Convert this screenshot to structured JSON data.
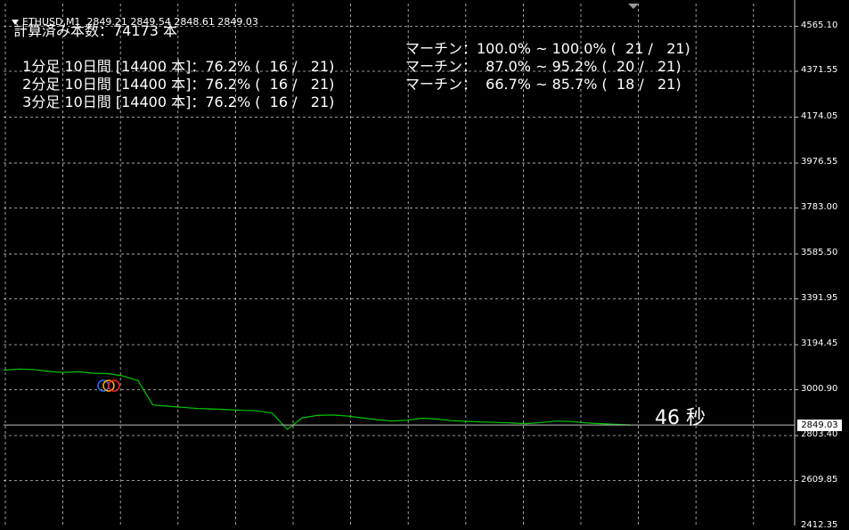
{
  "header": {
    "symbol": "ETHUSD,M1",
    "ohlc": "2849.21 2849.54 2848.61 2849.03"
  },
  "stats": {
    "calc_count": "計算済み本数：74173 本",
    "rows": [
      {
        "label": "1分足 10日間 [14400 本]：76.2% (  16 /   21)",
        "martin": "マーチン：100.0% ~ 100.0% (  21 /   21)"
      },
      {
        "label": "2分足 10日間 [14400 本]：76.2% (  16 /   21)",
        "martin": "マーチン：  87.0% ~ 95.2% (  20 /   21)"
      },
      {
        "label": "3分足 10日間 [14400 本]：76.2% (  16 /   21)",
        "martin": "マーチン：  66.7% ~ 85.7% (  18 /   21)"
      }
    ]
  },
  "timer": "46 秒",
  "current_price": "2849.03",
  "colors": {
    "background": "#000000",
    "grid": "#c8c8c8",
    "line": "#00c800",
    "price_line": "#c0c0c0"
  },
  "chart_data": {
    "type": "line",
    "title": "",
    "xlabel": "",
    "ylabel": "",
    "ylim": [
      2416.3,
      4663.0
    ],
    "y_ticks": [
      "4565.10",
      "4371.55",
      "4174.05",
      "3976.55",
      "3783.00",
      "3585.50",
      "3391.95",
      "3194.45",
      "3000.90",
      "2803.40",
      "2609.85",
      "2412.35"
    ],
    "y_tick_values": [
      4565.1,
      4371.55,
      4174.05,
      3976.55,
      3783.0,
      3585.5,
      3391.95,
      3194.45,
      3000.9,
      2803.4,
      2609.85,
      2412.35
    ],
    "grid": true,
    "current_price": 2849.03,
    "series": [
      {
        "values": [
          3085,
          3090,
          3088,
          3080,
          3075,
          3078,
          3072,
          3070,
          3060,
          3040,
          2935,
          2930,
          2925,
          2920,
          2918,
          2915,
          2912,
          2910,
          2900,
          2830,
          2880,
          2890,
          2892,
          2888,
          2880,
          2872,
          2866,
          2870,
          2878,
          2875,
          2868,
          2865,
          2862,
          2860,
          2858,
          2855,
          2860,
          2866,
          2864,
          2858,
          2855,
          2852,
          2849
        ]
      }
    ],
    "markers": [
      "blue-circle",
      "orange-circle",
      "red-circle"
    ]
  }
}
